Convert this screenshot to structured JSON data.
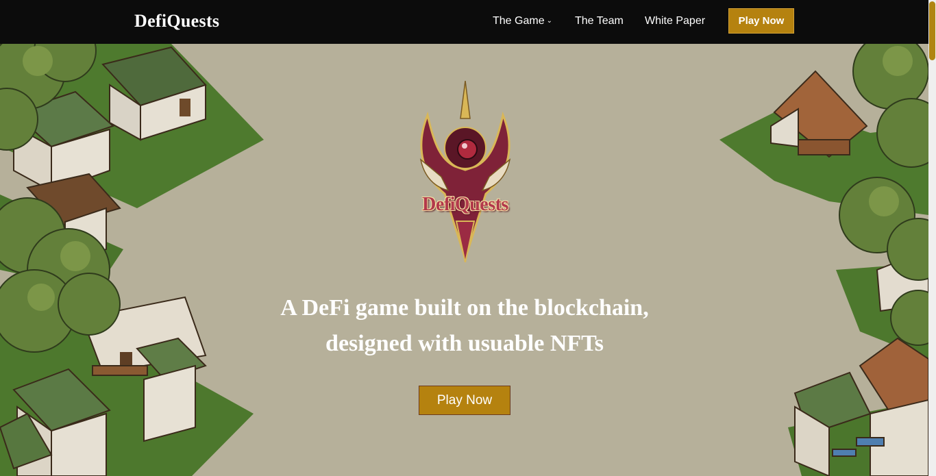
{
  "header": {
    "brand": "DefiQuests",
    "nav": [
      {
        "label": "The Game",
        "has_dropdown": true
      },
      {
        "label": "The Team",
        "has_dropdown": false
      },
      {
        "label": "White Paper",
        "has_dropdown": false
      }
    ],
    "play_button": "Play Now"
  },
  "hero": {
    "logo_text": "DefiQuests",
    "headline_line1": "A DeFi game built on the blockchain,",
    "headline_line2": "designed with usuable NFTs",
    "cta_button": "Play Now"
  },
  "icons": {
    "dropdown": "chevron-down-icon",
    "logo": "defiquests-crest-logo"
  },
  "colors": {
    "navbar_bg": "#0c0c0c",
    "accent": "#b5820f",
    "background": "#b6b09a",
    "text": "#ffffff",
    "logo_crimson": "#b2394c"
  }
}
